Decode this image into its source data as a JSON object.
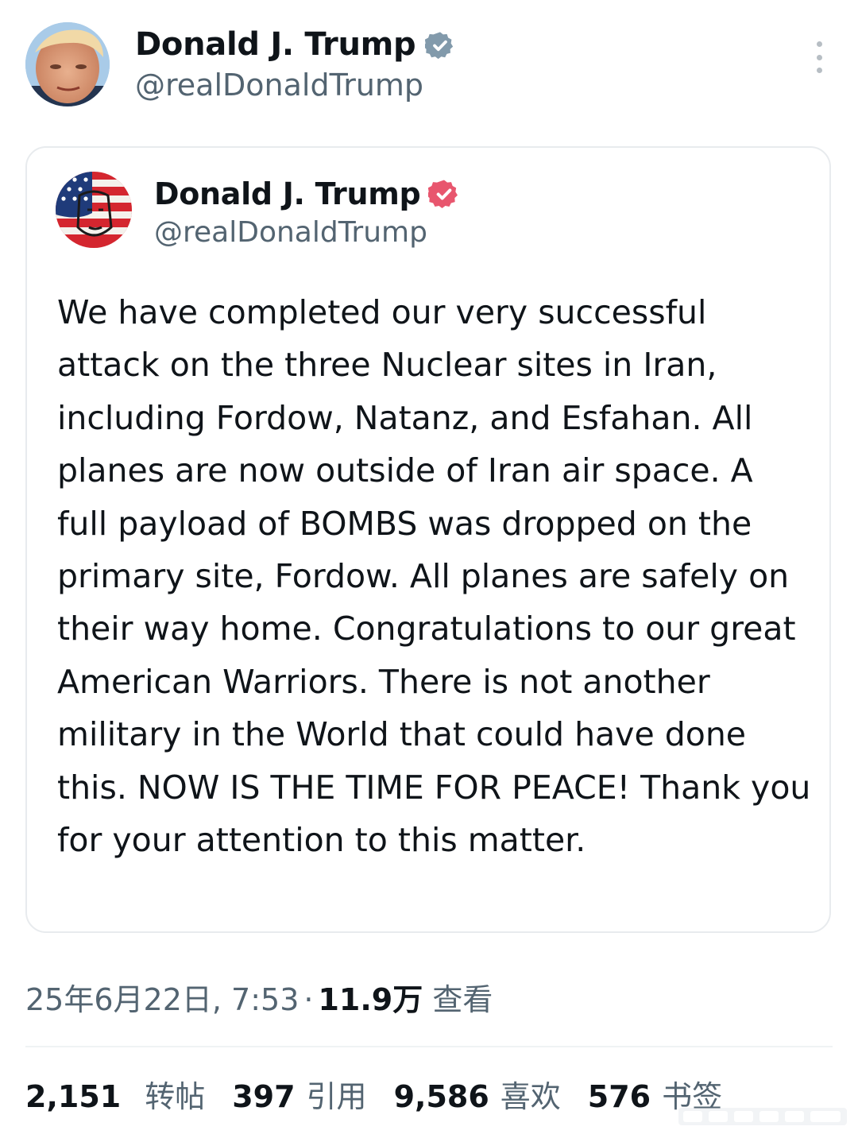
{
  "post": {
    "author": {
      "display_name": "Donald J. Trump",
      "handle": "@realDonaldTrump",
      "avatar_icon": "profile-photo-avatar",
      "verified_color": "#829aab"
    },
    "more_icon": "more-vertical-icon"
  },
  "quoted_post": {
    "author": {
      "display_name": "Donald J. Trump",
      "handle": "@realDonaldTrump",
      "avatar_icon": "flag-portrait-avatar",
      "verified_color": "#e8566e"
    },
    "text": "We have completed our very successful attack on the three Nuclear sites in Iran, including Fordow, Natanz, and Esfahan. All planes are now outside of Iran air space. A full payload of BOMBS was dropped on the primary site, Fordow. All planes are safely on their way home. Congratulations to our great American Warriors. There is not another military in the World that could have done this. NOW IS THE TIME FOR PEACE! Thank you for your attention to this matter."
  },
  "meta": {
    "timestamp": "25年6月22日, 7:53",
    "separator": "·",
    "views_count": "11.9万",
    "views_label": "查看"
  },
  "stats": {
    "reposts": {
      "count": "2,151",
      "label": "转帖"
    },
    "quotes": {
      "count": "397",
      "label": "引用"
    },
    "likes": {
      "count": "9,586",
      "label": "喜欢"
    },
    "bookmarks": {
      "count": "576",
      "label": "书签"
    }
  },
  "colors": {
    "text_primary": "#0f1419",
    "text_secondary": "#536471",
    "card_border": "#e8ebee"
  }
}
